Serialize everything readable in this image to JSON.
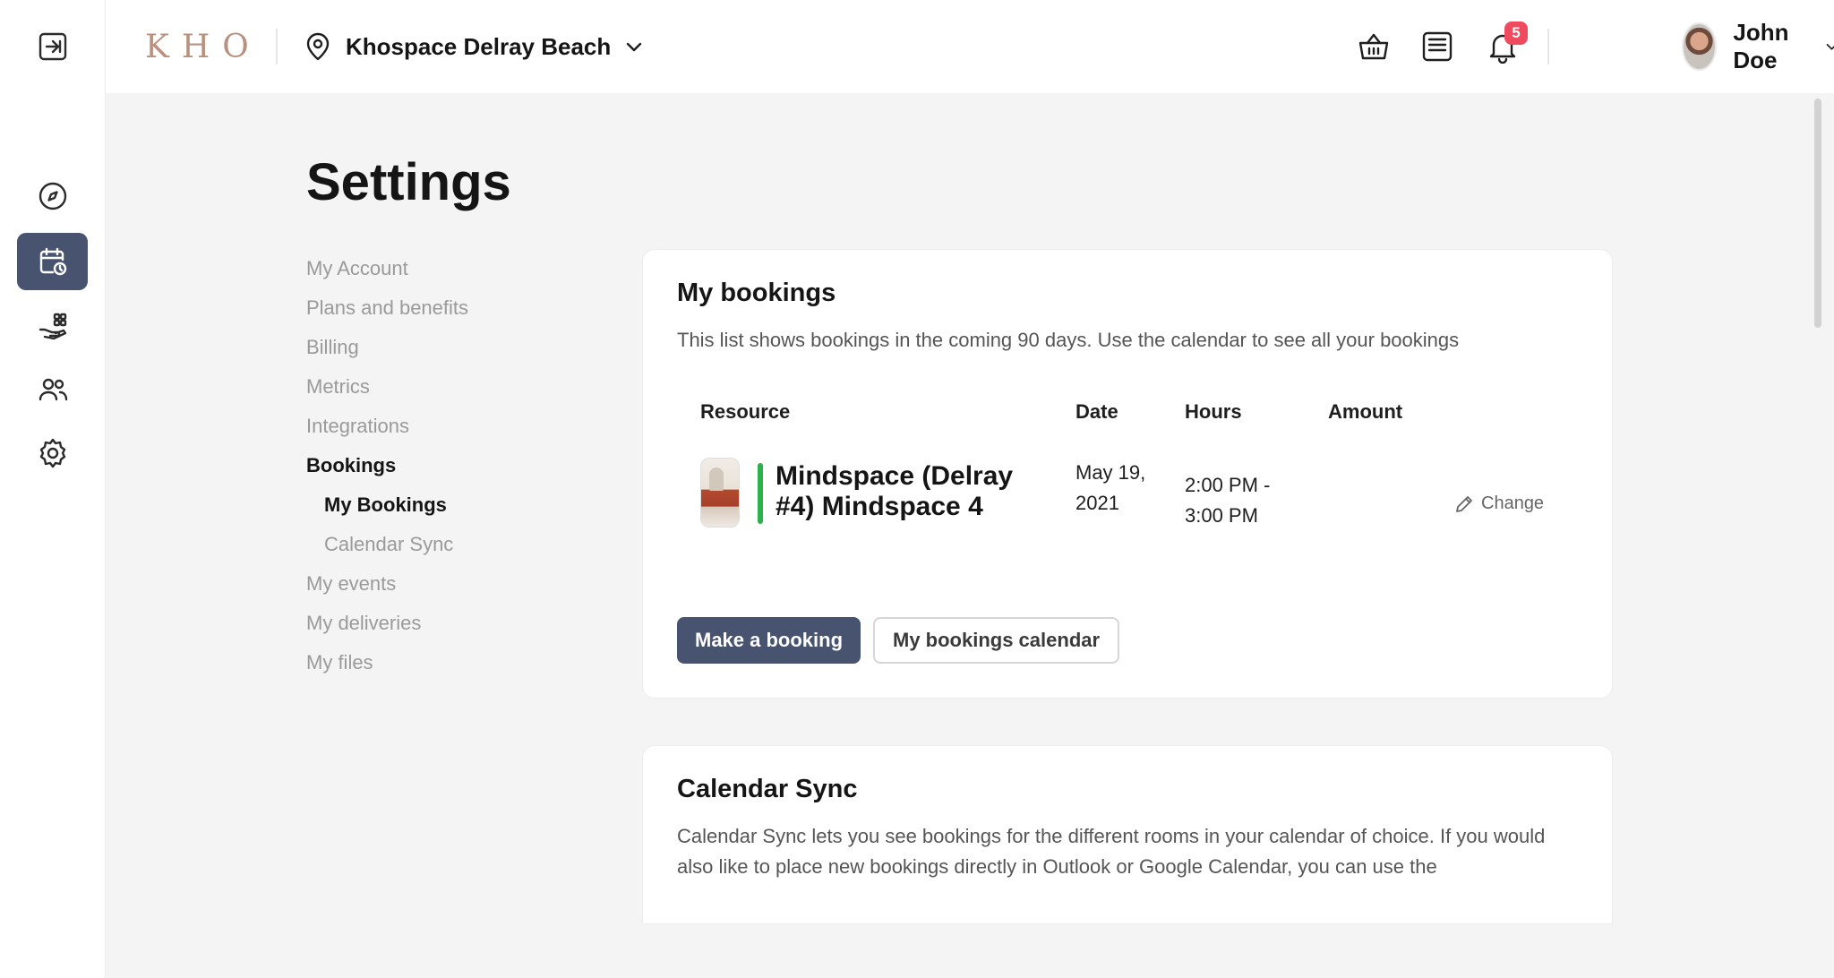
{
  "header": {
    "logo_text": "KHO",
    "location": "Khospace Delray Beach",
    "notification_count": "5",
    "user_name": "John Doe"
  },
  "rail": {
    "items": [
      "collapse",
      "explore",
      "bookings",
      "services",
      "community",
      "settings"
    ],
    "active": "bookings"
  },
  "page": {
    "title": "Settings"
  },
  "settings_nav": {
    "items": [
      {
        "label": "My Account"
      },
      {
        "label": "Plans and benefits"
      },
      {
        "label": "Billing"
      },
      {
        "label": "Metrics"
      },
      {
        "label": "Integrations"
      },
      {
        "label": "Bookings"
      },
      {
        "label": "My Bookings"
      },
      {
        "label": "Calendar Sync"
      },
      {
        "label": "My events"
      },
      {
        "label": "My deliveries"
      },
      {
        "label": "My files"
      }
    ]
  },
  "my_bookings": {
    "title": "My bookings",
    "description": "This list shows bookings in the coming 90 days. Use the calendar to see all your bookings",
    "columns": [
      "Resource",
      "Date",
      "Hours",
      "Amount"
    ],
    "rows": [
      {
        "resource": "Mindspace (Delray #4) Mindspace 4",
        "date": "May 19, 2021",
        "hours": "2:00 PM - 3:00 PM",
        "amount": "",
        "action": "Change"
      }
    ],
    "primary_button": "Make a booking",
    "secondary_button": "My bookings calendar"
  },
  "calendar_sync": {
    "title": "Calendar Sync",
    "description": "Calendar Sync lets you see bookings for the different rooms in your calendar of choice. If you would also like to place new bookings directly in Outlook or Google Calendar, you can use the"
  },
  "colors": {
    "accent": "#47536f",
    "badge": "#ef4a5d",
    "booking_marker": "#2bb24c",
    "logo": "#b8917e",
    "background": "#f4f4f4"
  }
}
